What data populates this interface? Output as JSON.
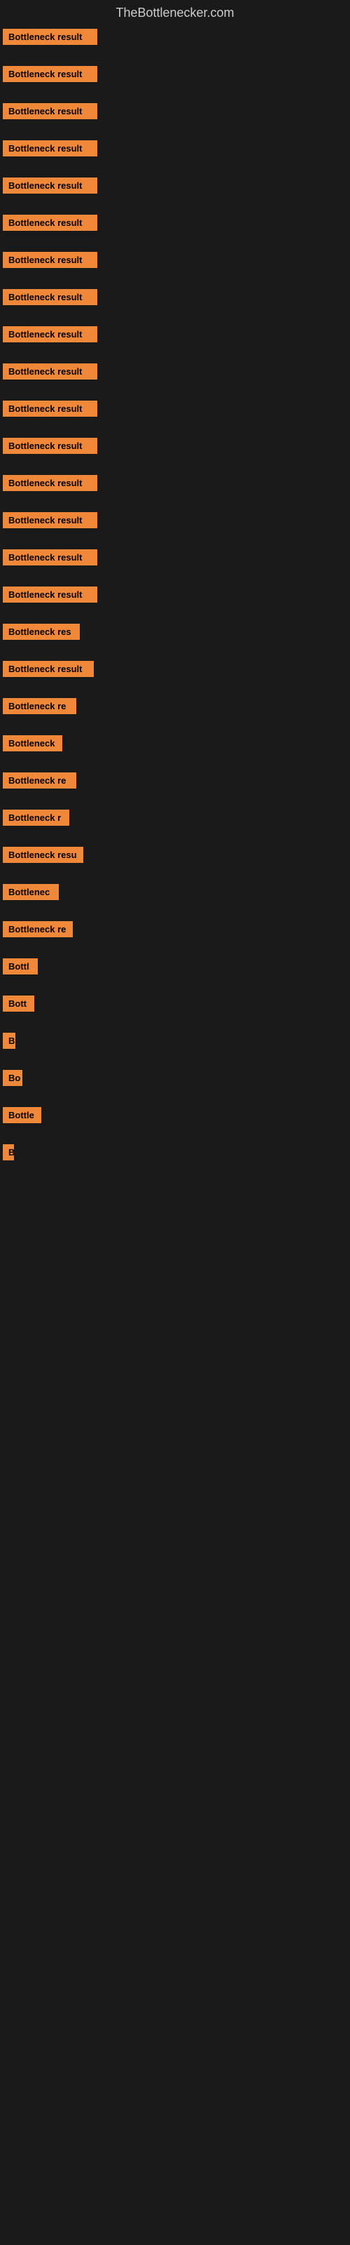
{
  "site": {
    "title": "TheBottlenecker.com"
  },
  "rows": [
    {
      "label": "Bottleneck result",
      "width": 135
    },
    {
      "label": "Bottleneck result",
      "width": 135
    },
    {
      "label": "Bottleneck result",
      "width": 135
    },
    {
      "label": "Bottleneck result",
      "width": 135
    },
    {
      "label": "Bottleneck result",
      "width": 135
    },
    {
      "label": "Bottleneck result",
      "width": 135
    },
    {
      "label": "Bottleneck result",
      "width": 135
    },
    {
      "label": "Bottleneck result",
      "width": 135
    },
    {
      "label": "Bottleneck result",
      "width": 135
    },
    {
      "label": "Bottleneck result",
      "width": 135
    },
    {
      "label": "Bottleneck result",
      "width": 135
    },
    {
      "label": "Bottleneck result",
      "width": 135
    },
    {
      "label": "Bottleneck result",
      "width": 135
    },
    {
      "label": "Bottleneck result",
      "width": 135
    },
    {
      "label": "Bottleneck result",
      "width": 135
    },
    {
      "label": "Bottleneck result",
      "width": 135
    },
    {
      "label": "Bottleneck res",
      "width": 110
    },
    {
      "label": "Bottleneck result",
      "width": 130
    },
    {
      "label": "Bottleneck re",
      "width": 105
    },
    {
      "label": "Bottleneck",
      "width": 85
    },
    {
      "label": "Bottleneck re",
      "width": 105
    },
    {
      "label": "Bottleneck r",
      "width": 95
    },
    {
      "label": "Bottleneck resu",
      "width": 115
    },
    {
      "label": "Bottlenec",
      "width": 80
    },
    {
      "label": "Bottleneck re",
      "width": 100
    },
    {
      "label": "Bottl",
      "width": 50
    },
    {
      "label": "Bott",
      "width": 45
    },
    {
      "label": "B",
      "width": 18
    },
    {
      "label": "Bo",
      "width": 28
    },
    {
      "label": "Bottle",
      "width": 55
    },
    {
      "label": "B",
      "width": 16
    }
  ]
}
